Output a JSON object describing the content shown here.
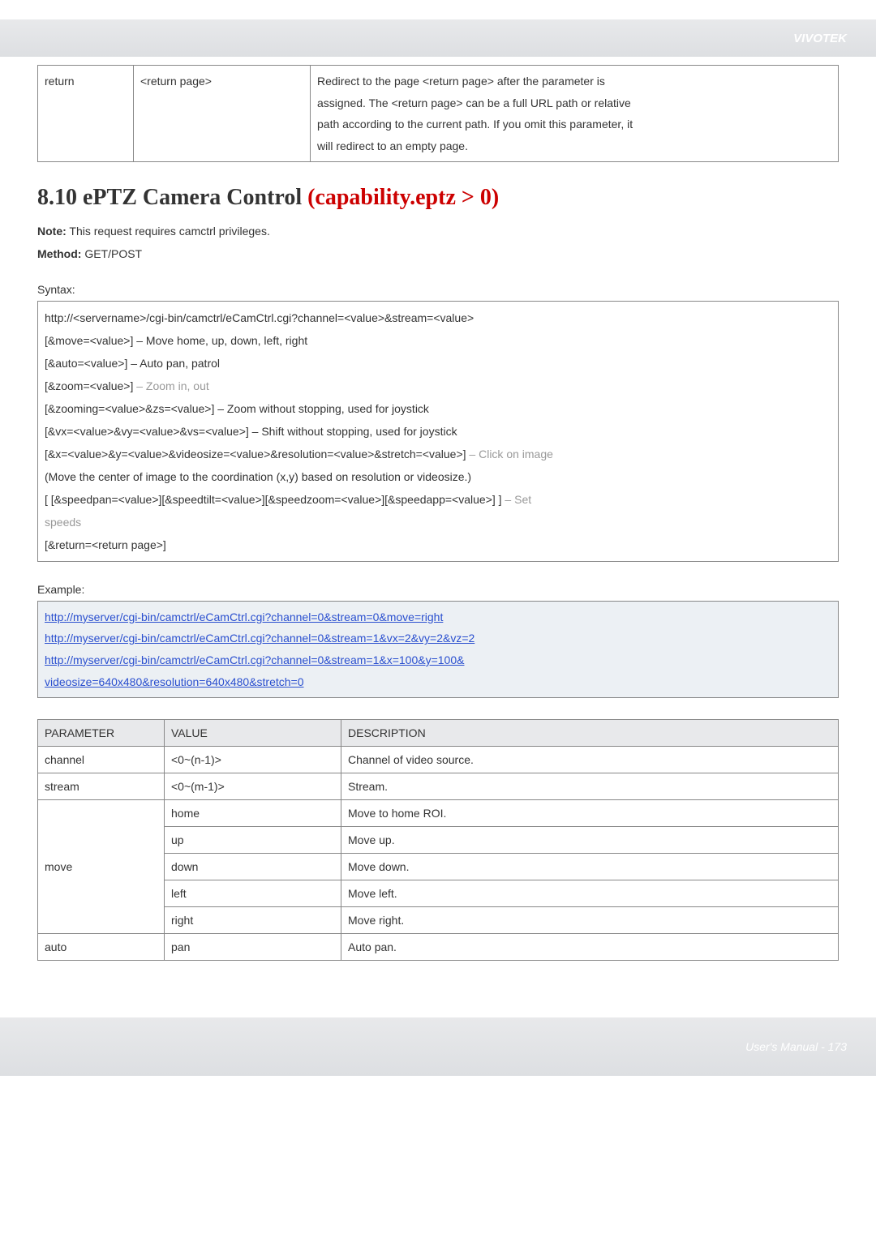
{
  "brand": "VIVOTEK",
  "top_table": {
    "param": "return",
    "value": "<return page>",
    "desc_l1": "Redirect to the page <return page> after the parameter is",
    "desc_l2": "assigned. The <return page> can be a full URL path or relative",
    "desc_l3": "path according to the current path. If you omit this parameter, it",
    "desc_l4": "will redirect to an empty page."
  },
  "section": {
    "number_title": "8.10 ePTZ Camera Control ",
    "red": "(capability.eptz > 0)"
  },
  "note": {
    "label": "Note:",
    "text": " This request requires camctrl privileges."
  },
  "method": {
    "label": "Method:",
    "text": " GET/POST"
  },
  "syntax_label": "Syntax:",
  "syntax": {
    "l1": "http://<servername>/cgi-bin/camctrl/eCamCtrl.cgi?channel=<value>&stream=<value>",
    "l2": "[&move=<value>] – Move home, up, down, left, right",
    "l3": "[&auto=<value>] – Auto pan, patrol",
    "l4a": "[&zoom=<value>]",
    "l4b": " – Zoom in, out",
    "l5": "[&zooming=<value>&zs=<value>] – Zoom without stopping, used for joystick",
    "l6": "[&vx=<value>&vy=<value>&vs=<value>] – Shift without stopping, used for joystick",
    "l7a": "[&x=<value>&y=<value>&videosize=<value>&resolution=<value>&stretch=<value>]",
    "l7b": " – Click on image",
    "l8": "(Move the center of image to the coordination (x,y) based on resolution or videosize.)",
    "l9a": "[ [&speedpan=<value>][&speedtilt=<value>][&speedzoom=<value>][&speedapp=<value>] ]",
    "l9b": " – Set",
    "l10": "speeds",
    "l11": "[&return=<return page>]"
  },
  "example_label": "Example:",
  "examples": {
    "e1": "http://myserver/cgi-bin/camctrl/eCamCtrl.cgi?channel=0&stream=0&move=right",
    "e2": "http://myserver/cgi-bin/camctrl/eCamCtrl.cgi?channel=0&stream=1&vx=2&vy=2&vz=2",
    "e3": "http://myserver/cgi-bin/camctrl/eCamCtrl.cgi?channel=0&stream=1&x=100&y=100&",
    "e4": "videosize=640x480&resolution=640x480&stretch=0"
  },
  "param_table": {
    "headers": {
      "p": "PARAMETER",
      "v": "VALUE",
      "d": "DESCRIPTION"
    },
    "rows": {
      "channel": {
        "p": "channel",
        "v": "<0~(n-1)>",
        "d": "Channel of video source."
      },
      "stream": {
        "p": "stream",
        "v": "<0~(m-1)>",
        "d": "Stream."
      },
      "move_home": {
        "p": "move",
        "v": "home",
        "d": "Move to home ROI."
      },
      "move_up": {
        "v": "up",
        "d": "Move up."
      },
      "move_down": {
        "v": "down",
        "d": "Move down."
      },
      "move_left": {
        "v": "left",
        "d": "Move left."
      },
      "move_right": {
        "v": "right",
        "d": "Move right."
      },
      "auto_pan": {
        "p": "auto",
        "v": "pan",
        "d": "Auto pan."
      }
    }
  },
  "footer": "User's Manual - 173"
}
